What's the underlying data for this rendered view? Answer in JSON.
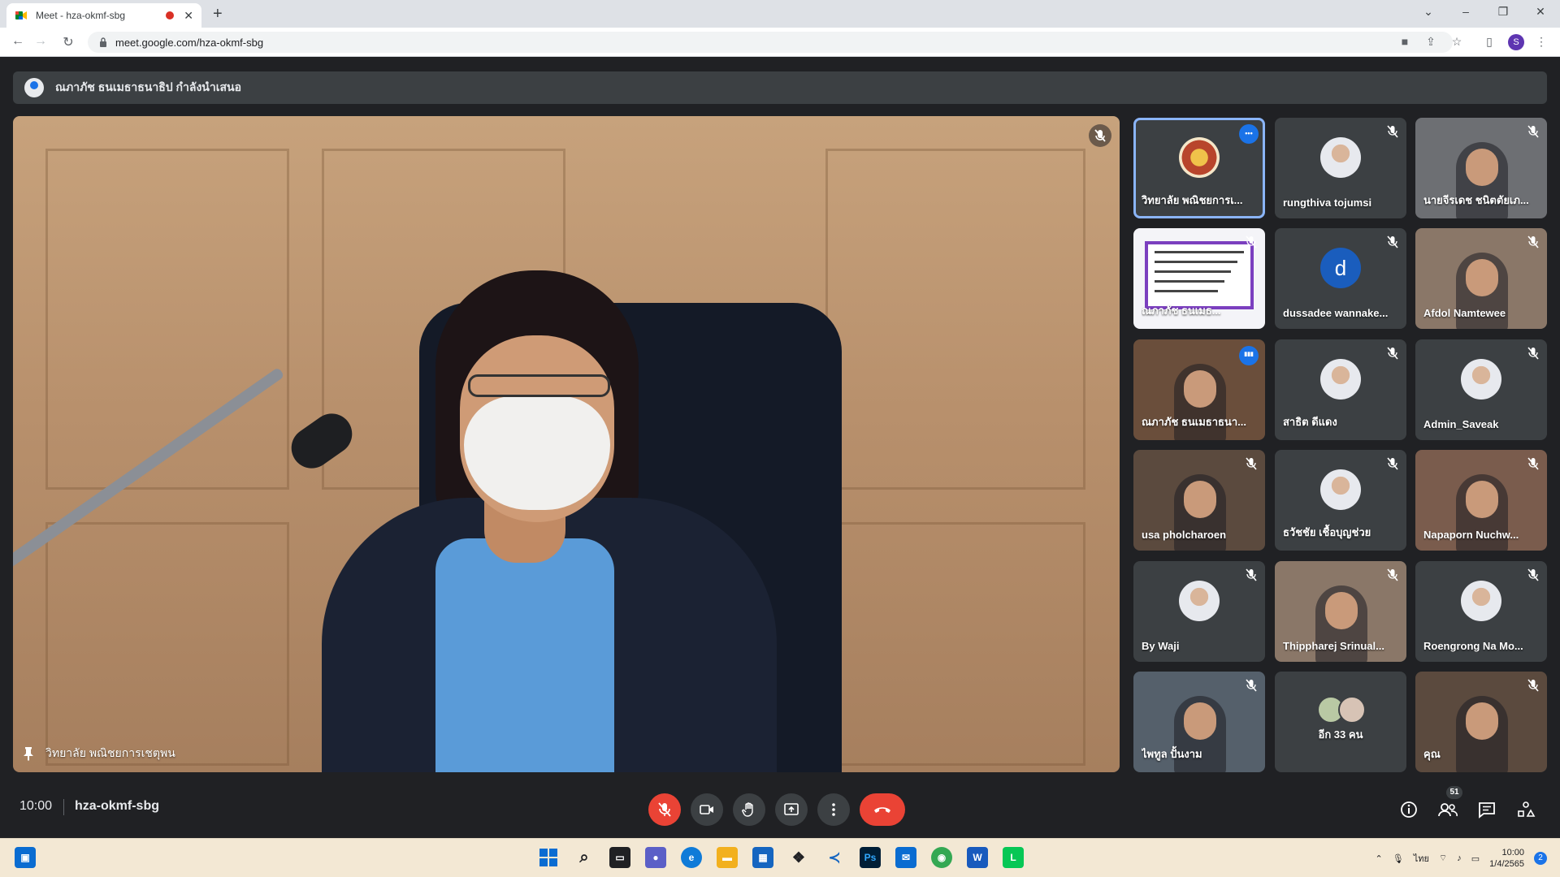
{
  "browser": {
    "tab_title": "Meet - hza-okmf-sbg",
    "url": "meet.google.com/hza-okmf-sbg",
    "profile_initial": "S"
  },
  "presentation_banner": "ณภาภัช ธนเมธาธนาธิป กำลังนำเสนอ",
  "main_speaker": "วิทยาลัย พณิชยการเชตุพน",
  "participants": [
    {
      "name": "วิทยาลัย พณิชยการเ...",
      "avatar": "seal",
      "active": true,
      "badge": "more"
    },
    {
      "name": "rungthiva tojumsi",
      "avatar": "photo",
      "muted": true
    },
    {
      "name": "นายจีรเดช ชนิตตัยเภ...",
      "avatar": "video",
      "muted": true
    },
    {
      "name": "ณภาภัช ธนเมธ...",
      "avatar": "slide",
      "muted": true
    },
    {
      "name": "dussadee wannake...",
      "avatar": "letter",
      "letter": "d",
      "muted": true
    },
    {
      "name": "Afdol Namtewee",
      "avatar": "video",
      "muted": true
    },
    {
      "name": "ณภาภัช ธนเมธาธนา...",
      "avatar": "video",
      "badge": "speaking"
    },
    {
      "name": "สาธิต ดีแดง",
      "avatar": "photo",
      "muted": true
    },
    {
      "name": "Admin_Saveak",
      "avatar": "photo",
      "muted": true
    },
    {
      "name": "usa pholcharoen",
      "avatar": "video",
      "muted": true
    },
    {
      "name": "ธวัชชัย เชื้อบุญช่วย",
      "avatar": "photo",
      "muted": true
    },
    {
      "name": "Napaporn Nuchw...",
      "avatar": "video",
      "muted": true
    },
    {
      "name": "By Waji",
      "avatar": "photo",
      "muted": true
    },
    {
      "name": "Thippharej Srinual...",
      "avatar": "video",
      "muted": true
    },
    {
      "name": "Roengrong Na Mo...",
      "avatar": "photo",
      "muted": true
    },
    {
      "name": "ไพทูล ปั้นงาม",
      "avatar": "video",
      "muted": true
    },
    {
      "name": "อีก 33 คน",
      "avatar": "group"
    },
    {
      "name": "คุณ",
      "avatar": "video",
      "muted": true
    }
  ],
  "meeting": {
    "time": "10:00",
    "code": "hza-okmf-sbg",
    "participant_count": "51"
  },
  "taskbar": {
    "language": "ไทย",
    "time": "10:00",
    "date": "1/4/2565",
    "notifications": "2"
  },
  "colors": {
    "meet_bg": "#202124",
    "tile_bg": "#3c4043",
    "accent_blue": "#1a73e8",
    "end_call_red": "#ea4335"
  }
}
